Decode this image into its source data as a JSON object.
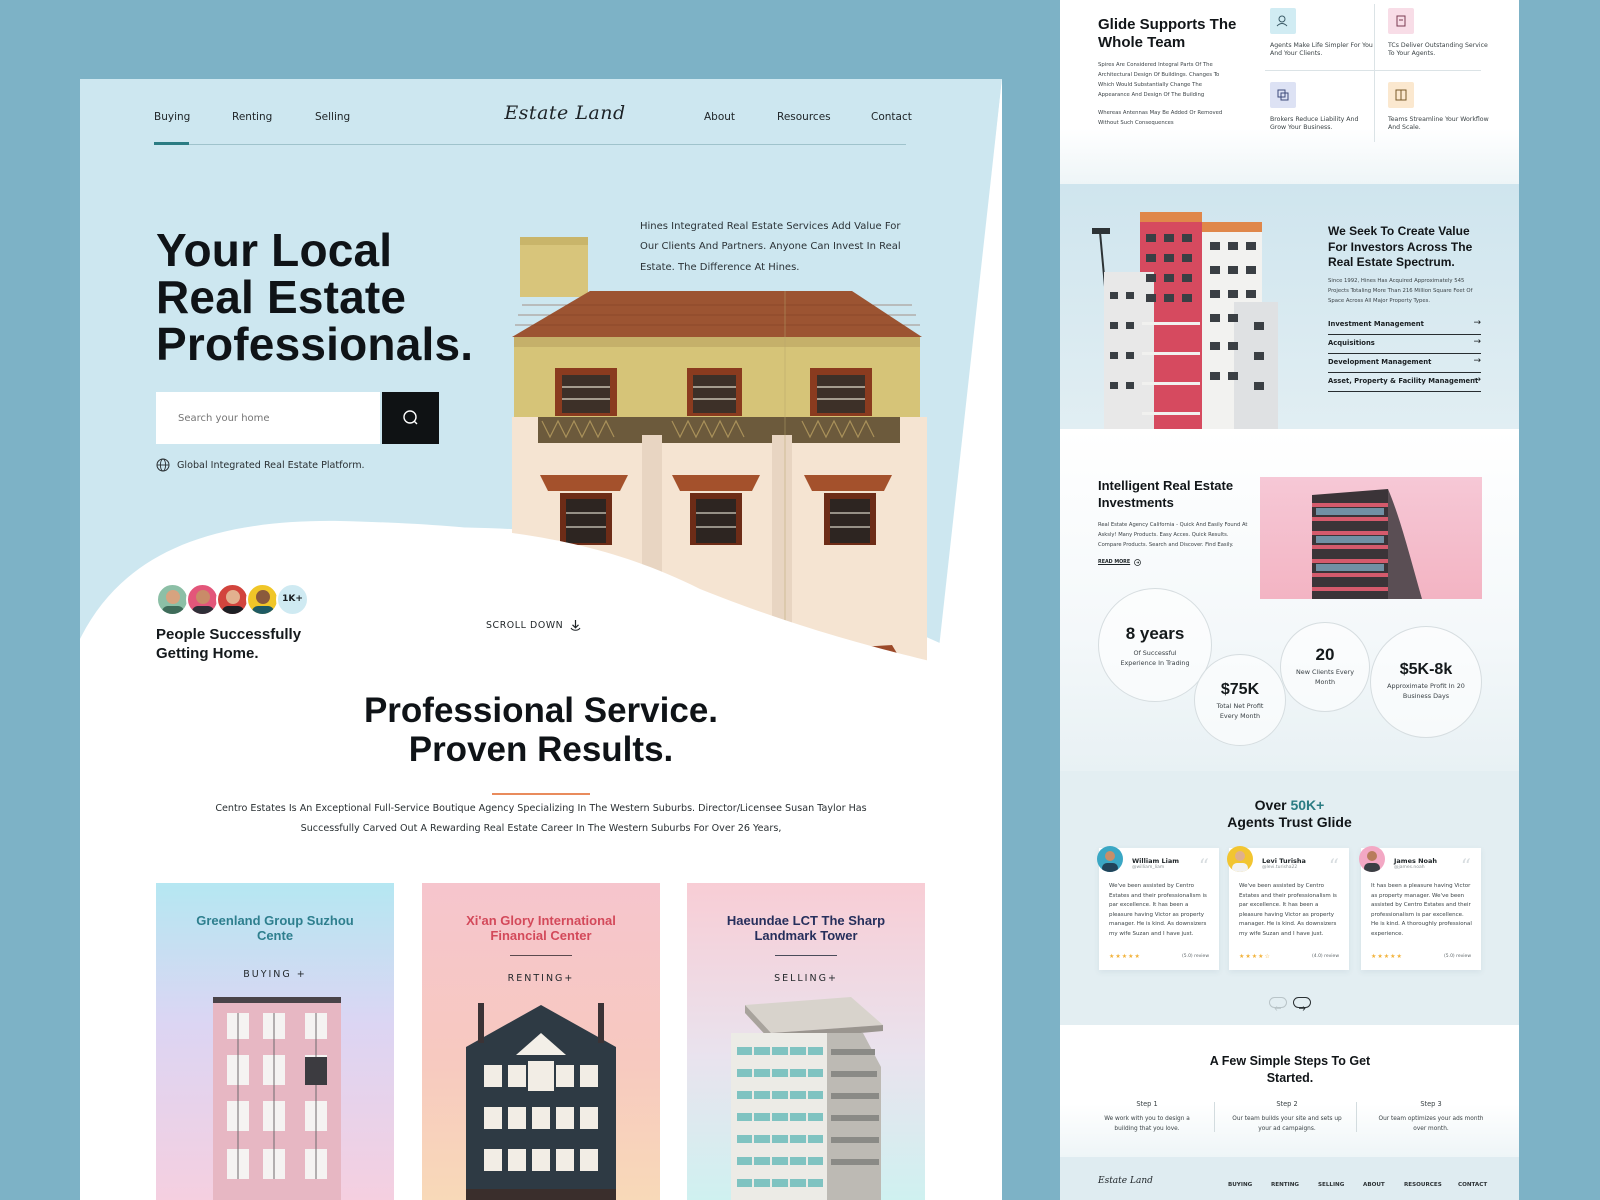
{
  "left": {
    "nav": {
      "left_links": [
        "Buying",
        "Renting",
        "Selling"
      ],
      "logo": "Estate Land",
      "right_links": [
        "About",
        "Resources",
        "Contact"
      ]
    },
    "hero": {
      "title_lines": [
        "Your Local",
        "Real Estate",
        "Professionals."
      ],
      "search_placeholder": "Search your home",
      "info_text": "Hines Integrated Real Estate Services Add Value For Our Clients And Partners. Anyone Can Invest In Real Estate. The Difference At Hines.",
      "platform_label": "Global Integrated Real Estate Platform.",
      "avatars_more": "1K+",
      "people_text": "People Successfully Getting Home.",
      "scroll_label": "SCROLL DOWN"
    },
    "services": {
      "title_line1": "Professional Service.",
      "title_line2": "Proven Results.",
      "description": "Centro Estates Is An Exceptional Full-Service Boutique Agency Specializing In The Western Suburbs. Director/Licensee Susan Taylor Has Successfully Carved Out A Rewarding Real Estate Career In The Western Suburbs For Over 26 Years,",
      "cards": [
        {
          "title": "Greenland Group Suzhou Cente",
          "label": "BUYING +",
          "title_color": "#2e7f8e"
        },
        {
          "title": "Xi'an Glory International Financial Center",
          "label": "RENTING+",
          "title_color": "#d3495a"
        },
        {
          "title": "Haeundae LCT The Sharp Landmark Tower",
          "label": "SELLING+",
          "title_color": "#262f5c"
        }
      ]
    }
  },
  "right": {
    "support": {
      "title": "Glide Supports The Whole Team",
      "text1": "Spires Are Considered Integral Parts Of The Architectural Design Of Buildings. Changes To Which Would Substantially Change The Appearance And Design Of The Building",
      "text2": "Whereas Antennas May Be Added Or Removed Without Such Consequences",
      "features": [
        {
          "icon": "team-icon",
          "text": "Agents Make Life Simpler For You And Your Clients."
        },
        {
          "icon": "service-icon",
          "text": "TCs Deliver Outstanding Service To Your Agents."
        },
        {
          "icon": "layers-icon",
          "text": "Brokers Reduce Liability And Grow Your Business."
        },
        {
          "icon": "workflow-icon",
          "text": "Teams Streamline Your Workflow And Scale."
        }
      ]
    },
    "value": {
      "title": "We Seek To Create Value For Investors Across The Real Estate Spectrum.",
      "text": "Since 1992, Hines Has Acquired Approximately 545 Projects Totaling More Than 216 Million Square Feet Of Space Across All Major Property Types.",
      "menu": [
        "Investment Management",
        "Acquisitions",
        "Development Management",
        "Asset, Property & Facility Management"
      ]
    },
    "invest": {
      "title": "Intelligent Real Estate Investments",
      "text": "Real Estate Agency California - Quick And Easily Found At Asksly! Many Products. Easy Acces. Quick Results. Compare Products. Search and Discover. Find Easily.",
      "read_more": "READ MORE"
    },
    "stats": [
      {
        "value": "8 years",
        "desc": "Of Successful Experience In Trading"
      },
      {
        "value": "$75K",
        "desc": "Total Net Profit Every Month"
      },
      {
        "value": "20",
        "desc": "New Clients Every Month"
      },
      {
        "value": "$5K-8k",
        "desc": "Approximate Profit In 20 Business Days"
      }
    ],
    "trust": {
      "title_prefix": "Over",
      "title_highlight": "50K+",
      "title_suffix": "Agents Trust Glide",
      "reviews": [
        {
          "name": "William Liam",
          "handle": "@william_liam",
          "text": "We've been assisted by Centro Estates and their professionalism is par excellence. It has been a pleasure having Victor as property manager. He is kind. As downsizers my wife Suzan and I have just.",
          "stars": "★★★★★",
          "rating": "(5.0) review"
        },
        {
          "name": "Levi Turisha",
          "handle": "@levi.turisha22",
          "text": "We've been assisted by Centro Estates and their professionalism is par excellence. It has been a pleasure having Victor as property manager. He is kind. As downsizers my wife Suzan and I have just.",
          "stars": "★★★★☆",
          "rating": "(4.0) review"
        },
        {
          "name": "James Noah",
          "handle": "@james.noah",
          "text": "It has been a pleasure having Victor as property manager. We've been assisted by Centro Estates and their professionalism is par excellence. He is kind. A thoroughly professional experience.",
          "stars": "★★★★★",
          "rating": "(5.0) review"
        }
      ]
    },
    "steps": {
      "title": "A Few Simple Steps To Get Started.",
      "items": [
        {
          "label": "Step 1",
          "text": "We work with you to design a building that you love."
        },
        {
          "label": "Step 2",
          "text": "Our team builds your site and sets up your ad campaigns."
        },
        {
          "label": "Step 3",
          "text": "Our team optimizes your ads month over month."
        }
      ]
    },
    "footer": {
      "logo": "Estate Land",
      "links": [
        "BUYING",
        "RENTING",
        "SELLING",
        "ABOUT",
        "RESOURCES",
        "CONTACT"
      ]
    }
  },
  "colors": {
    "background": "#7db2c6",
    "hero_blue": "#cde7f0",
    "accent_orange": "#e98b5c",
    "nav_accent": "#2b7c83",
    "highlight_teal": "#2b7c83"
  }
}
